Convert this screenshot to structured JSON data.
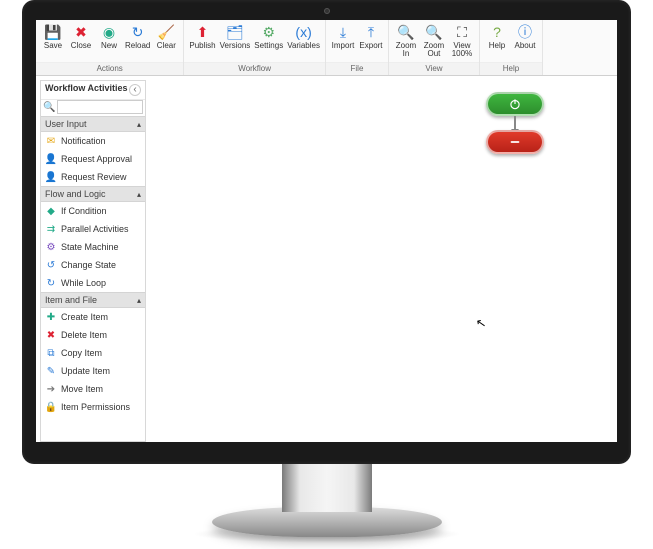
{
  "ribbon": {
    "groups": [
      {
        "title": "Actions",
        "buttons": [
          {
            "name": "save-button",
            "label": "Save",
            "icon": "save-icon",
            "glyph": "💾",
            "cls": "ic-save"
          },
          {
            "name": "close-button",
            "label": "Close",
            "icon": "close-icon",
            "glyph": "✖",
            "cls": "ic-close"
          },
          {
            "name": "new-button",
            "label": "New",
            "icon": "new-icon",
            "glyph": "◉",
            "cls": "ic-new"
          },
          {
            "name": "reload-button",
            "label": "Reload",
            "icon": "reload-icon",
            "glyph": "↻",
            "cls": "ic-reload"
          },
          {
            "name": "clear-button",
            "label": "Clear",
            "icon": "clear-icon",
            "glyph": "🧹",
            "cls": "ic-clear"
          }
        ]
      },
      {
        "title": "Workflow",
        "buttons": [
          {
            "name": "publish-button",
            "label": "Publish",
            "icon": "publish-icon",
            "glyph": "⬆",
            "cls": "ic-publish"
          },
          {
            "name": "versions-button",
            "label": "Versions",
            "icon": "versions-icon",
            "glyph": "🗂",
            "cls": "ic-versions"
          },
          {
            "name": "settings-button",
            "label": "Settings",
            "icon": "settings-icon",
            "glyph": "⚙",
            "cls": "ic-settings"
          },
          {
            "name": "variables-button",
            "label": "Variables",
            "icon": "variables-icon",
            "glyph": "(x)",
            "cls": "ic-vars"
          }
        ]
      },
      {
        "title": "File",
        "buttons": [
          {
            "name": "import-button",
            "label": "Import",
            "icon": "import-icon",
            "glyph": "⤓",
            "cls": "ic-import"
          },
          {
            "name": "export-button",
            "label": "Export",
            "icon": "export-icon",
            "glyph": "⤒",
            "cls": "ic-export"
          }
        ]
      },
      {
        "title": "View",
        "buttons": [
          {
            "name": "zoom-in-button",
            "label": "Zoom\nIn",
            "icon": "zoom-in-icon",
            "glyph": "🔍",
            "cls": "ic-zoom"
          },
          {
            "name": "zoom-out-button",
            "label": "Zoom\nOut",
            "icon": "zoom-out-icon",
            "glyph": "🔍",
            "cls": "ic-zoom"
          },
          {
            "name": "view-100-button",
            "label": "View\n100%",
            "icon": "view-100-icon",
            "glyph": "⛶",
            "cls": "ic-zoom"
          }
        ]
      },
      {
        "title": "Help",
        "buttons": [
          {
            "name": "help-button",
            "label": "Help",
            "icon": "help-icon",
            "glyph": "?",
            "cls": "ic-help"
          },
          {
            "name": "about-button",
            "label": "About",
            "icon": "about-icon",
            "glyph": "ⓘ",
            "cls": "ic-about"
          }
        ]
      }
    ]
  },
  "sidebar": {
    "title": "Workflow Activities",
    "search_value": "",
    "categories": [
      {
        "name": "User Input",
        "items": [
          {
            "label": "Notification",
            "icon": "notification-icon",
            "glyph": "✉",
            "cls": "ai-yellow"
          },
          {
            "label": "Request Approval",
            "icon": "request-approval-icon",
            "glyph": "👤",
            "cls": "ai-red"
          },
          {
            "label": "Request Review",
            "icon": "request-review-icon",
            "glyph": "👤",
            "cls": "ai-yellow"
          }
        ]
      },
      {
        "name": "Flow and Logic",
        "items": [
          {
            "label": "If Condition",
            "icon": "if-condition-icon",
            "glyph": "◆",
            "cls": "ai-green"
          },
          {
            "label": "Parallel Activities",
            "icon": "parallel-activities-icon",
            "glyph": "⇉",
            "cls": "ai-green"
          },
          {
            "label": "State Machine",
            "icon": "state-machine-icon",
            "glyph": "⚙",
            "cls": "ai-purple"
          },
          {
            "label": "Change State",
            "icon": "change-state-icon",
            "glyph": "↺",
            "cls": "ai-blue"
          },
          {
            "label": "While Loop",
            "icon": "while-loop-icon",
            "glyph": "↻",
            "cls": "ai-blue"
          }
        ]
      },
      {
        "name": "Item and File",
        "items": [
          {
            "label": "Create Item",
            "icon": "create-item-icon",
            "glyph": "✚",
            "cls": "ai-green"
          },
          {
            "label": "Delete Item",
            "icon": "delete-item-icon",
            "glyph": "✖",
            "cls": "ai-red"
          },
          {
            "label": "Copy Item",
            "icon": "copy-item-icon",
            "glyph": "⧉",
            "cls": "ai-blue"
          },
          {
            "label": "Update Item",
            "icon": "update-item-icon",
            "glyph": "✎",
            "cls": "ai-blue"
          },
          {
            "label": "Move Item",
            "icon": "move-item-icon",
            "glyph": "➔",
            "cls": "ai-gray"
          },
          {
            "label": "Item Permissions",
            "icon": "item-permissions-icon",
            "glyph": "🔒",
            "cls": "ai-yellow"
          }
        ]
      }
    ]
  },
  "canvas": {
    "start_node": "start",
    "end_node": "end"
  }
}
